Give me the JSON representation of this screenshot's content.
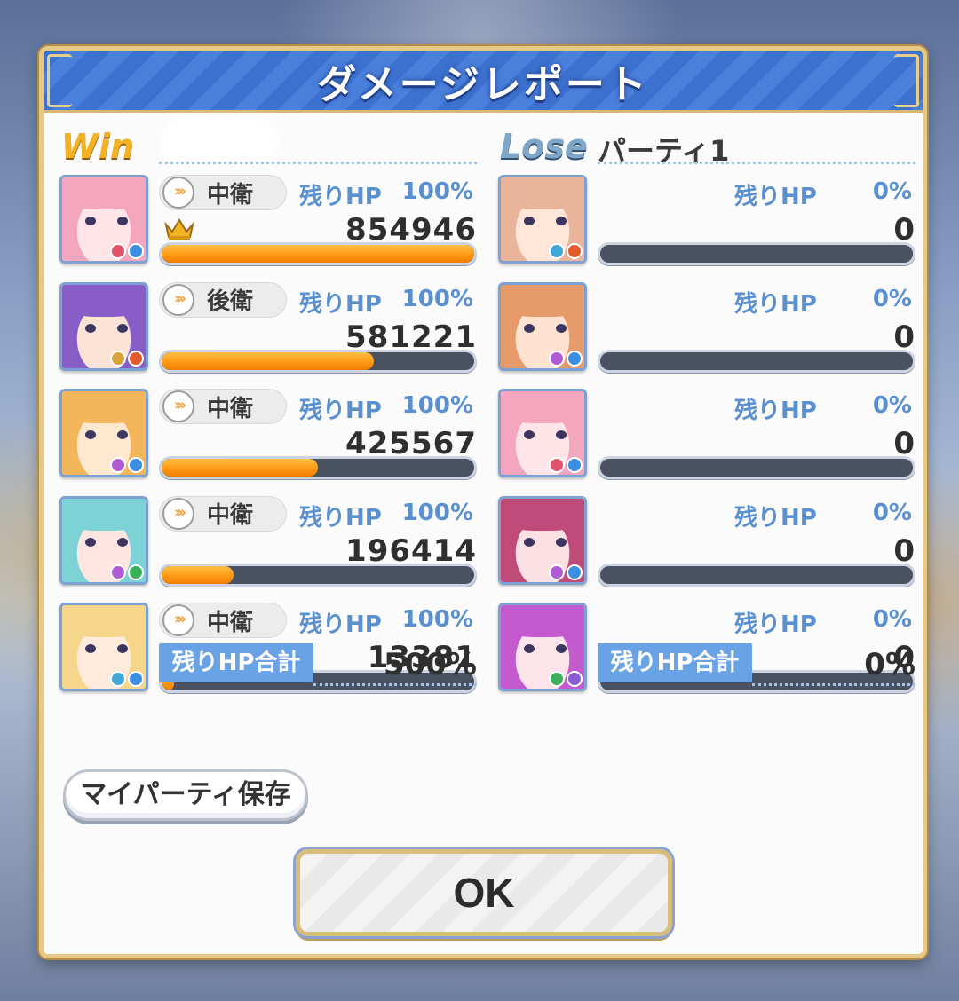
{
  "title": "ダメージレポート",
  "win": {
    "badge": "Win",
    "party_name": "",
    "members": [
      {
        "position": "中衛",
        "hp_label": "残りHP",
        "hp_pct": "100%",
        "damage": "854946",
        "bar_fraction": 1.0,
        "mvp": true,
        "hair": "#f4a6bf",
        "skin": "#ffe4e8",
        "attr": [
          "#e0536a",
          "#3c8ee0"
        ]
      },
      {
        "position": "後衛",
        "hp_label": "残りHP",
        "hp_pct": "100%",
        "damage": "581221",
        "bar_fraction": 0.68,
        "mvp": false,
        "hair": "#8a5cc8",
        "skin": "#fde2d6",
        "attr": [
          "#d9a43a",
          "#e25a2c"
        ]
      },
      {
        "position": "中衛",
        "hp_label": "残りHP",
        "hp_pct": "100%",
        "damage": "425567",
        "bar_fraction": 0.5,
        "mvp": false,
        "hair": "#f4b65a",
        "skin": "#ffe8cf",
        "attr": [
          "#b05ad6",
          "#3c8ee0"
        ]
      },
      {
        "position": "中衛",
        "hp_label": "残りHP",
        "hp_pct": "100%",
        "damage": "196414",
        "bar_fraction": 0.23,
        "mvp": false,
        "hair": "#7cd2d4",
        "skin": "#ffe6e0",
        "attr": [
          "#b05ad6",
          "#3bb05a"
        ]
      },
      {
        "position": "中衛",
        "hp_label": "残りHP",
        "hp_pct": "100%",
        "damage": "13381",
        "bar_fraction": 0.04,
        "mvp": false,
        "hair": "#f6d68a",
        "skin": "#ffeadc",
        "attr": [
          "#3ea9d8",
          "#3c8ee0"
        ]
      }
    ],
    "total_label": "残りHP合計",
    "total_value": "500%"
  },
  "lose": {
    "badge": "Lose",
    "party_name": "パーティ1",
    "members": [
      {
        "hp_label": "残りHP",
        "hp_pct": "0%",
        "damage": "0",
        "bar_fraction": 0,
        "hair": "#e9b49a",
        "skin": "#ffe6d8",
        "attr": [
          "#3ea9d8",
          "#e25a2c"
        ]
      },
      {
        "hp_label": "残りHP",
        "hp_pct": "0%",
        "damage": "0",
        "bar_fraction": 0,
        "hair": "#e79a6a",
        "skin": "#ffe2d0",
        "attr": [
          "#b05ad6",
          "#3c8ee0"
        ]
      },
      {
        "hp_label": "残りHP",
        "hp_pct": "0%",
        "damage": "0",
        "bar_fraction": 0,
        "hair": "#f4a6bf",
        "skin": "#ffe4e8",
        "attr": [
          "#e0536a",
          "#3c8ee0"
        ]
      },
      {
        "hp_label": "残りHP",
        "hp_pct": "0%",
        "damage": "0",
        "bar_fraction": 0,
        "hair": "#c04a78",
        "skin": "#fbe0e4",
        "attr": [
          "#b05ad6",
          "#3c8ee0"
        ]
      },
      {
        "hp_label": "残りHP",
        "hp_pct": "0%",
        "damage": "0",
        "bar_fraction": 0,
        "hair": "#c35ad0",
        "skin": "#fde4ea",
        "attr": [
          "#3bb05a",
          "#8a5cd0"
        ]
      }
    ],
    "total_label": "残りHP合計",
    "total_value": "0%"
  },
  "buttons": {
    "save_party": "マイパーティ保存",
    "ok": "OK"
  }
}
